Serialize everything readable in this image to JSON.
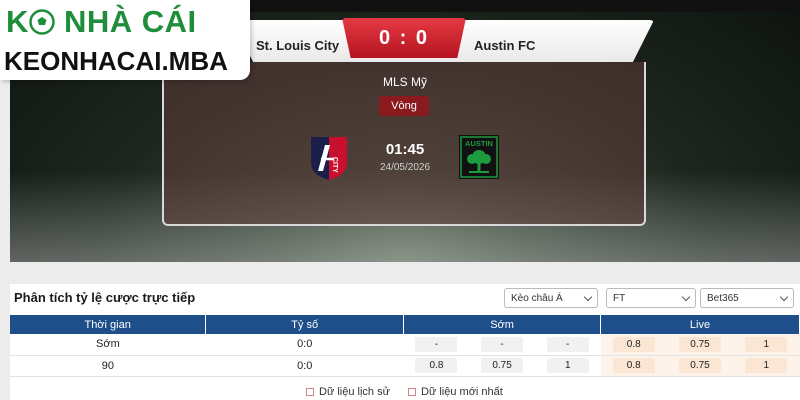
{
  "brand": {
    "line1": "KÈO NHÀ CÁI",
    "line2": "KEONHACAI.MBA"
  },
  "match": {
    "home_team": "St. Louis City",
    "away_team": "Austin FC",
    "score": "0 : 0",
    "league": "MLS Mỹ",
    "round": "Vòng",
    "time": "01:45",
    "date": "24/05/2026",
    "home_logo_text": "CITY",
    "away_logo_text": "AUSTIN"
  },
  "analysis": {
    "title": "Phân tích tỷ lệ cược trực tiếp",
    "selects": [
      "Kèo châu Á",
      "FT",
      "Bet365"
    ],
    "columns": [
      "Thời gian",
      "Tỷ số",
      "Sớm",
      "Live"
    ],
    "rows": [
      {
        "time": "Sớm",
        "score": "0:0",
        "early": [
          "-",
          "-",
          "-"
        ],
        "live": [
          "0.8",
          "0.75",
          "1"
        ]
      },
      {
        "time": "90",
        "score": "0:0",
        "early": [
          "0.8",
          "0.75",
          "1"
        ],
        "live": [
          "0.8",
          "0.75",
          "1"
        ]
      }
    ],
    "legend": [
      "Dữ liệu lịch sử",
      "Dữ liệu mới nhất"
    ]
  },
  "colors": {
    "header": "#1f4f8a",
    "score_red": "#c8202b",
    "brand_green": "#1f8e3a",
    "austin_green": "#1c9b3f"
  }
}
